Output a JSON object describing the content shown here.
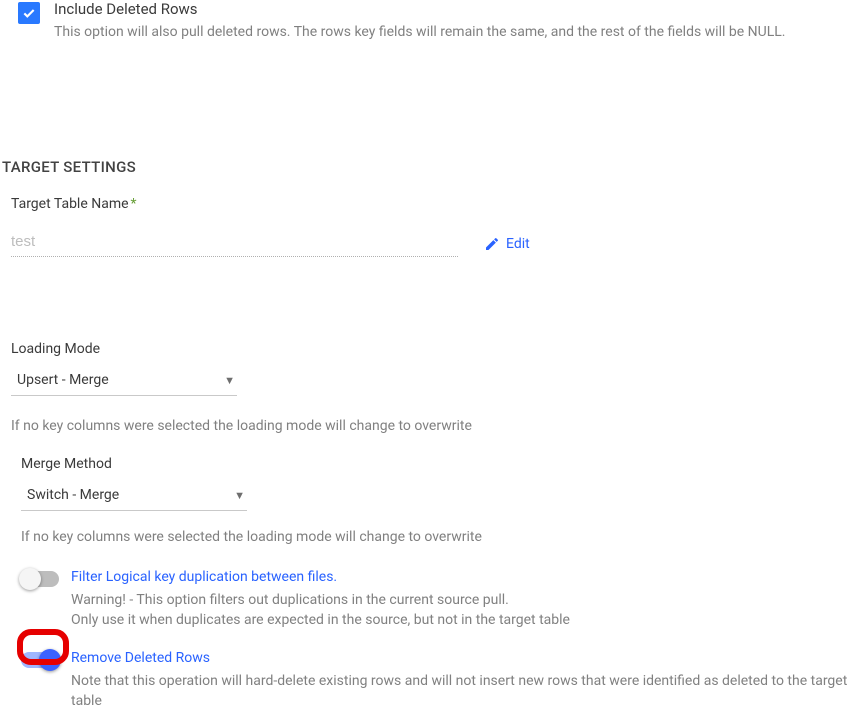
{
  "includeDeleted": {
    "title": "Include Deleted Rows",
    "desc": "This option will also pull deleted rows. The rows key fields will remain the same, and the rest of the fields will be NULL."
  },
  "sectionHeader": "TARGET SETTINGS",
  "targetTable": {
    "label": "Target Table Name",
    "value": "test",
    "editLabel": "Edit"
  },
  "loadingMode": {
    "label": "Loading Mode",
    "value": "Upsert - Merge",
    "hint": "If no key columns were selected the loading mode will change to overwrite"
  },
  "mergeMethod": {
    "label": "Merge Method",
    "value": "Switch - Merge",
    "hint": "If no key columns were selected the loading mode will change to overwrite"
  },
  "filterDup": {
    "link": "Filter Logical key duplication between files.",
    "warn1": "Warning! - This option filters out duplications in the current source pull.",
    "warn2": "Only use it when duplicates are expected in the source, but not in the target table"
  },
  "removeDeleted": {
    "link": "Remove Deleted Rows",
    "desc": "Note that this operation will hard-delete existing rows and will not insert new rows that were identified as deleted to the target table"
  }
}
